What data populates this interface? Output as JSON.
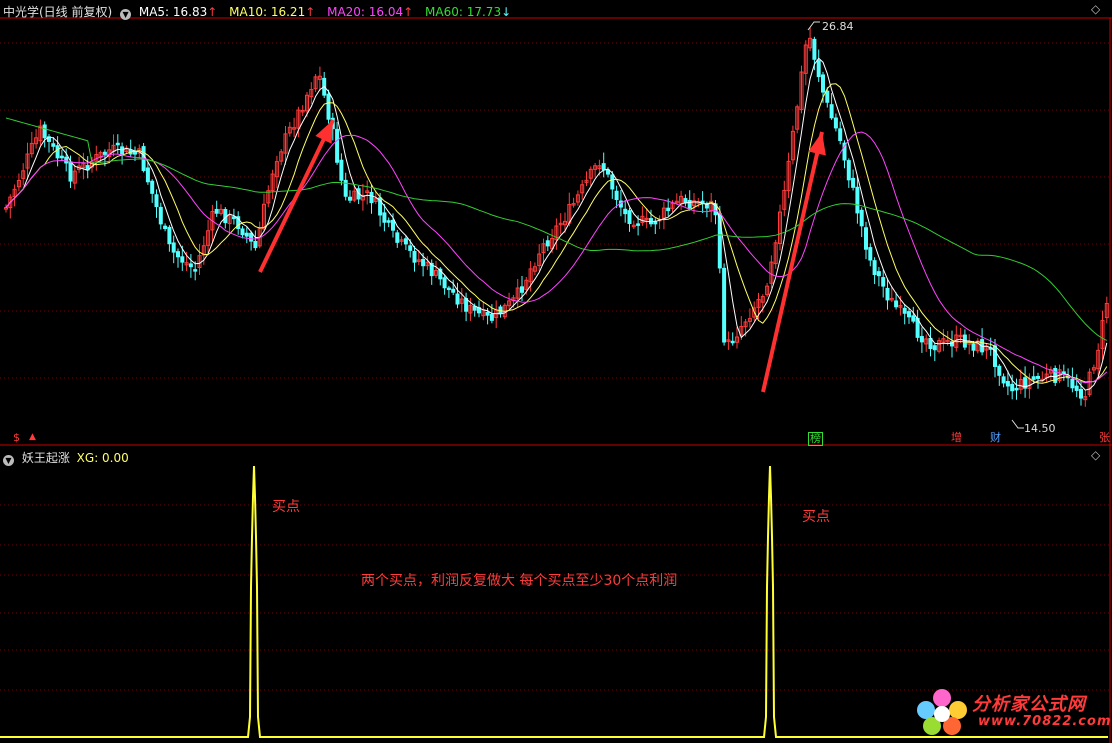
{
  "header": {
    "title": "中光学(日线 前复权)",
    "ma5": "MA5: 16.83",
    "ma10": "MA10: 16.21",
    "ma20": "MA20: 16.04",
    "ma60": "MA60: 17.73",
    "up_arrow": "↑",
    "down_arrow": "↓"
  },
  "indicator": {
    "name": "妖王起涨",
    "value": "XG: 0.00"
  },
  "chart_data": [
    {
      "type": "candlestick",
      "title": "中光学(日线 前复权)",
      "series": [
        {
          "name": "MA5",
          "value": 16.83,
          "color": "#ffffff"
        },
        {
          "name": "MA10",
          "value": 16.21,
          "color": "#ffff66"
        },
        {
          "name": "MA20",
          "value": 16.04,
          "color": "#ff44ff"
        },
        {
          "name": "MA60",
          "value": 17.73,
          "color": "#33cc33"
        }
      ],
      "price_high_label": "26.84",
      "price_low_label": "14.50",
      "candle_colors": {
        "up": "#ff3b3b",
        "down": "#54ffff"
      }
    },
    {
      "type": "line",
      "title": "妖王起涨",
      "series": [
        {
          "name": "XG",
          "color": "#ffff33"
        }
      ],
      "signals_x_index": [
        84,
        258
      ],
      "signal_value": 1,
      "current_value": 0.0
    }
  ],
  "annotations": {
    "buy_point_1": "买点",
    "buy_point_2": "买点",
    "comment": "两个买点，利润反复做大 每个买点至少30个点利润"
  },
  "tags": {
    "s": "$",
    "rank": "榜",
    "increase": "增",
    "finance": "财",
    "limit_up": "张"
  },
  "watermark": {
    "name": "分析家公式网",
    "url": "www.70822.com"
  },
  "colors": {
    "background": "#000000",
    "grid": "#7a0000",
    "separator": "#c80000",
    "arrow": "#ff3030",
    "annotation": "#ff3c3c"
  }
}
